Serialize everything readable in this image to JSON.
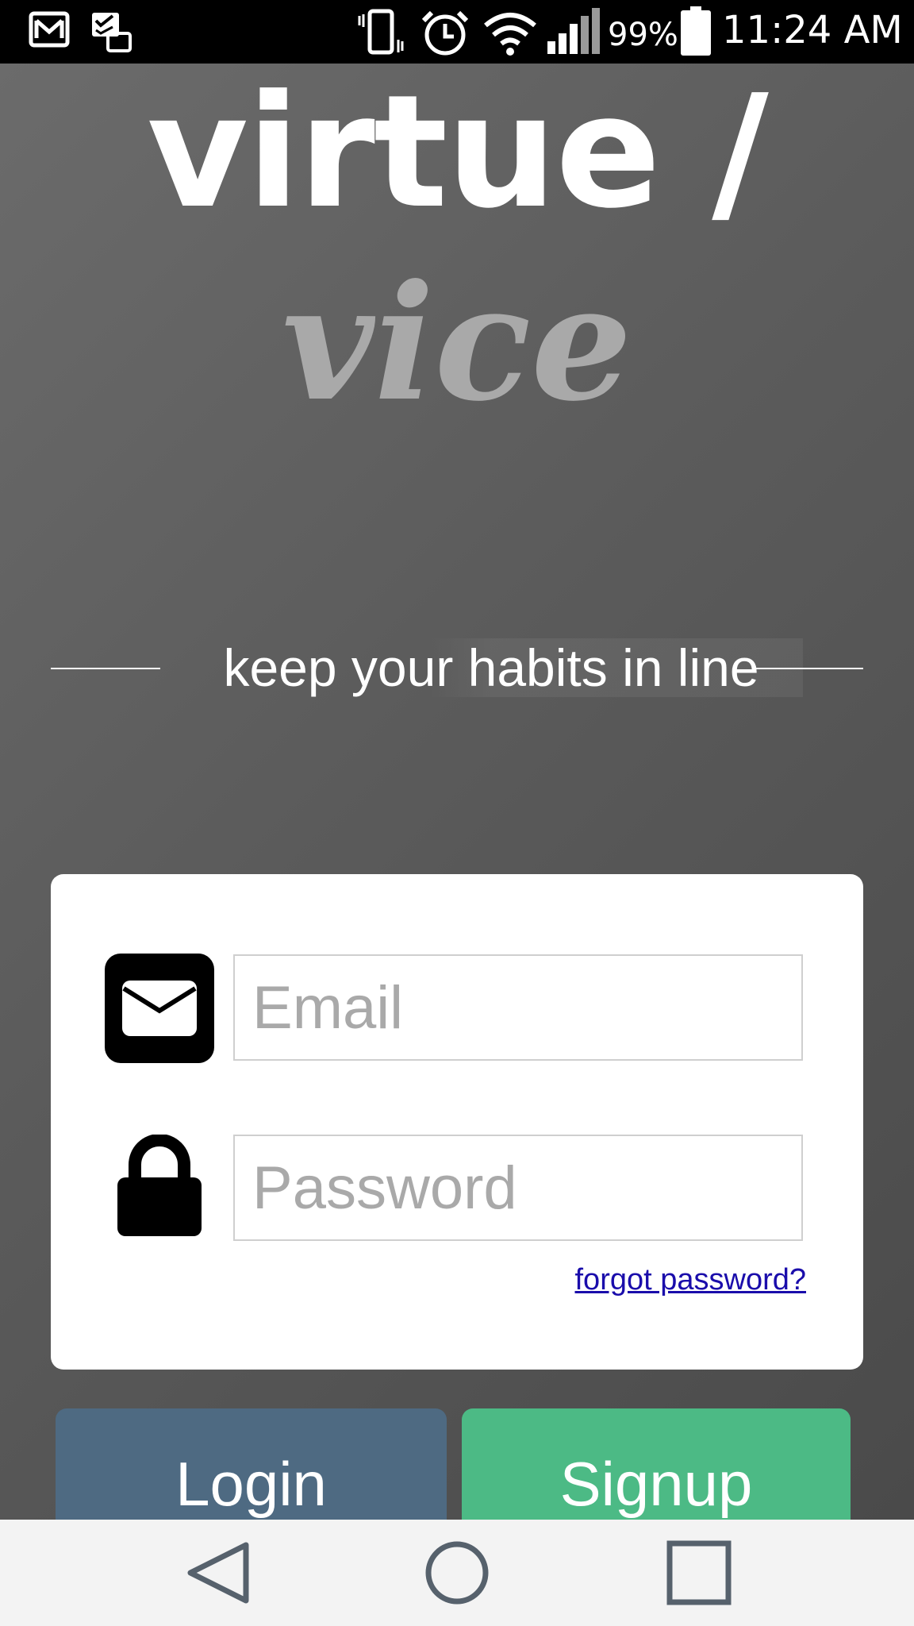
{
  "status_bar": {
    "battery": "99%",
    "time": "11:24 AM",
    "icons": [
      "gmail-icon",
      "task-icon",
      "vibrate-icon",
      "alarm-icon",
      "wifi-icon",
      "signal-icon",
      "battery-icon"
    ]
  },
  "app": {
    "title_line1": "virtue /",
    "title_line2": "vice",
    "tagline": "keep your habits in line"
  },
  "login_form": {
    "email_placeholder": "Email",
    "password_placeholder": "Password",
    "forgot_password": "forgot password?"
  },
  "buttons": {
    "login": "Login",
    "signup": "Signup"
  },
  "colors": {
    "login_button": "#4e6a82",
    "signup_button": "#4cba85",
    "title_secondary": "#a9a9a9"
  },
  "nav_bar": {
    "icons": [
      "back-icon",
      "home-icon",
      "recents-icon"
    ]
  }
}
